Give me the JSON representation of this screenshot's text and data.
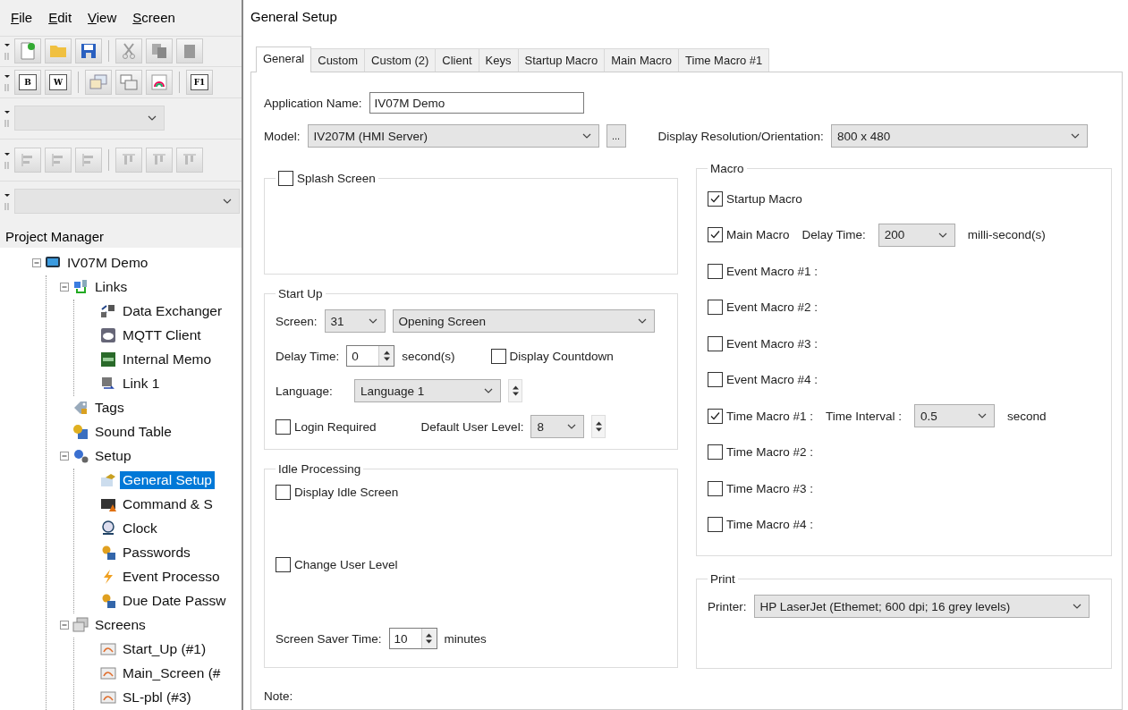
{
  "menu": [
    "File",
    "Edit",
    "View",
    "Screen"
  ],
  "toolbars": [
    {
      "kind": "file"
    },
    {
      "kind": "keys",
      "keys": [
        "B",
        "W",
        "F1"
      ]
    },
    {
      "kind": "combo"
    },
    {
      "kind": "align"
    },
    {
      "kind": "combo"
    }
  ],
  "project_manager": {
    "title": "Project Manager",
    "tree": [
      {
        "label": "IV07M Demo",
        "selected": false,
        "expanded": true,
        "children": [
          {
            "label": "Links",
            "selected": false,
            "expanded": true,
            "children": [
              {
                "label": "Data Exchanger",
                "selected": false
              },
              {
                "label": "MQTT Client",
                "selected": false
              },
              {
                "label": "Internal Memo",
                "selected": false
              },
              {
                "label": "Link 1",
                "selected": false
              }
            ]
          },
          {
            "label": "Tags",
            "selected": false
          },
          {
            "label": "Sound Table",
            "selected": false
          },
          {
            "label": "Setup",
            "selected": false,
            "expanded": true,
            "children": [
              {
                "label": "General Setup",
                "selected": true
              },
              {
                "label": "Command & S",
                "selected": false
              },
              {
                "label": "Clock",
                "selected": false
              },
              {
                "label": "Passwords",
                "selected": false
              },
              {
                "label": "Event Processo",
                "selected": false
              },
              {
                "label": "Due Date Passw",
                "selected": false
              }
            ]
          },
          {
            "label": "Screens",
            "selected": false,
            "expanded": true,
            "children": [
              {
                "label": "Start_Up (#1)",
                "selected": false
              },
              {
                "label": "Main_Screen (#",
                "selected": false
              },
              {
                "label": "SL-pbl (#3)",
                "selected": false
              }
            ]
          }
        ]
      }
    ]
  },
  "dialog": {
    "title": "General Setup",
    "tabs": [
      {
        "label": "General",
        "selected": true
      },
      {
        "label": "Custom",
        "selected": false
      },
      {
        "label": "Custom (2)",
        "selected": false
      },
      {
        "label": "Client",
        "selected": false
      },
      {
        "label": "Keys",
        "selected": false
      },
      {
        "label": "Startup Macro",
        "selected": false
      },
      {
        "label": "Main Macro",
        "selected": false
      },
      {
        "label": "Time Macro #1",
        "selected": false
      }
    ],
    "application_name": {
      "label": "Application Name:",
      "value": "IV07M Demo"
    },
    "model": {
      "label": "Model:",
      "value": "IV207M (HMI Server)",
      "more": "..."
    },
    "display_resolution": {
      "label": "Display Resolution/Orientation:",
      "value": "800 x 480"
    },
    "splash_screen": {
      "label": "Splash Screen",
      "checked": false
    },
    "start_up": {
      "title": "Start Up",
      "screen_label": "Screen:",
      "screen_number": "31",
      "screen_name": "Opening Screen",
      "delay_label": "Delay Time:",
      "delay_value": "0",
      "delay_unit": "second(s)",
      "display_countdown": {
        "label": "Display Countdown",
        "checked": false
      },
      "language_label": "Language:",
      "language_value": "Language 1",
      "login_required": {
        "label": "Login Required",
        "checked": false
      },
      "user_level_label": "Default User Level:",
      "user_level_value": "8"
    },
    "idle_processing": {
      "title": "Idle Processing",
      "display_idle_screen": {
        "label": "Display Idle Screen",
        "checked": false
      },
      "change_user_level": {
        "label": "Change User Level",
        "checked": false
      },
      "saver_label": "Screen Saver Time:",
      "saver_value": "10",
      "saver_unit": "minutes"
    },
    "note_label": "Note:",
    "macro": {
      "title": "Macro",
      "items": [
        {
          "kind": "plain",
          "label": "Startup Macro",
          "checked": true
        },
        {
          "kind": "timed",
          "label": "Main Macro",
          "checked": true,
          "setting_label": "Delay Time:",
          "setting_value": "200",
          "setting_unit": "milli-second(s)"
        },
        {
          "kind": "plain",
          "label": "Event Macro #1 :",
          "checked": false
        },
        {
          "kind": "plain",
          "label": "Event Macro #2 :",
          "checked": false
        },
        {
          "kind": "plain",
          "label": "Event Macro #3 :",
          "checked": false
        },
        {
          "kind": "plain",
          "label": "Event Macro #4 :",
          "checked": false
        },
        {
          "kind": "timed",
          "label": "Time Macro #1 :",
          "checked": true,
          "setting_label": "Time Interval :",
          "setting_value": "0.5",
          "setting_unit": "second"
        },
        {
          "kind": "plain",
          "label": "Time Macro #2 :",
          "checked": false
        },
        {
          "kind": "plain",
          "label": "Time Macro #3 :",
          "checked": false
        },
        {
          "kind": "plain",
          "label": "Time Macro #4 :",
          "checked": false
        }
      ]
    },
    "print": {
      "title": "Print",
      "printer_label": "Printer:",
      "printer_value": "HP LaserJet (Ethemet; 600 dpi; 16 grey levels)"
    }
  }
}
